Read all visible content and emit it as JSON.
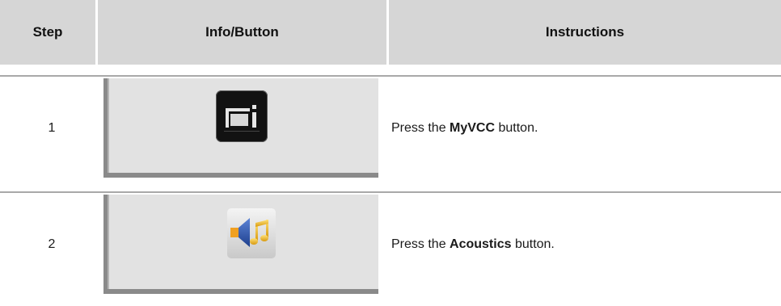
{
  "table": {
    "headers": {
      "step": "Step",
      "info": "Info/Button",
      "instructions": "Instructions"
    },
    "rows": [
      {
        "step": "1",
        "icon": "myvcc-icon",
        "instr_pre": "Press the ",
        "instr_bold": "MyVCC",
        "instr_post": " button."
      },
      {
        "step": "2",
        "icon": "acoustics-icon",
        "instr_pre": "Press the ",
        "instr_bold": "Acoustics",
        "instr_post": " button."
      }
    ]
  },
  "colors": {
    "header_bg": "#d6d6d6",
    "panel_bg": "#e2e2e2",
    "rule": "#a9a9a9",
    "speaker_blue": "#2a4fa0",
    "note_gold": "#e8b21a"
  }
}
